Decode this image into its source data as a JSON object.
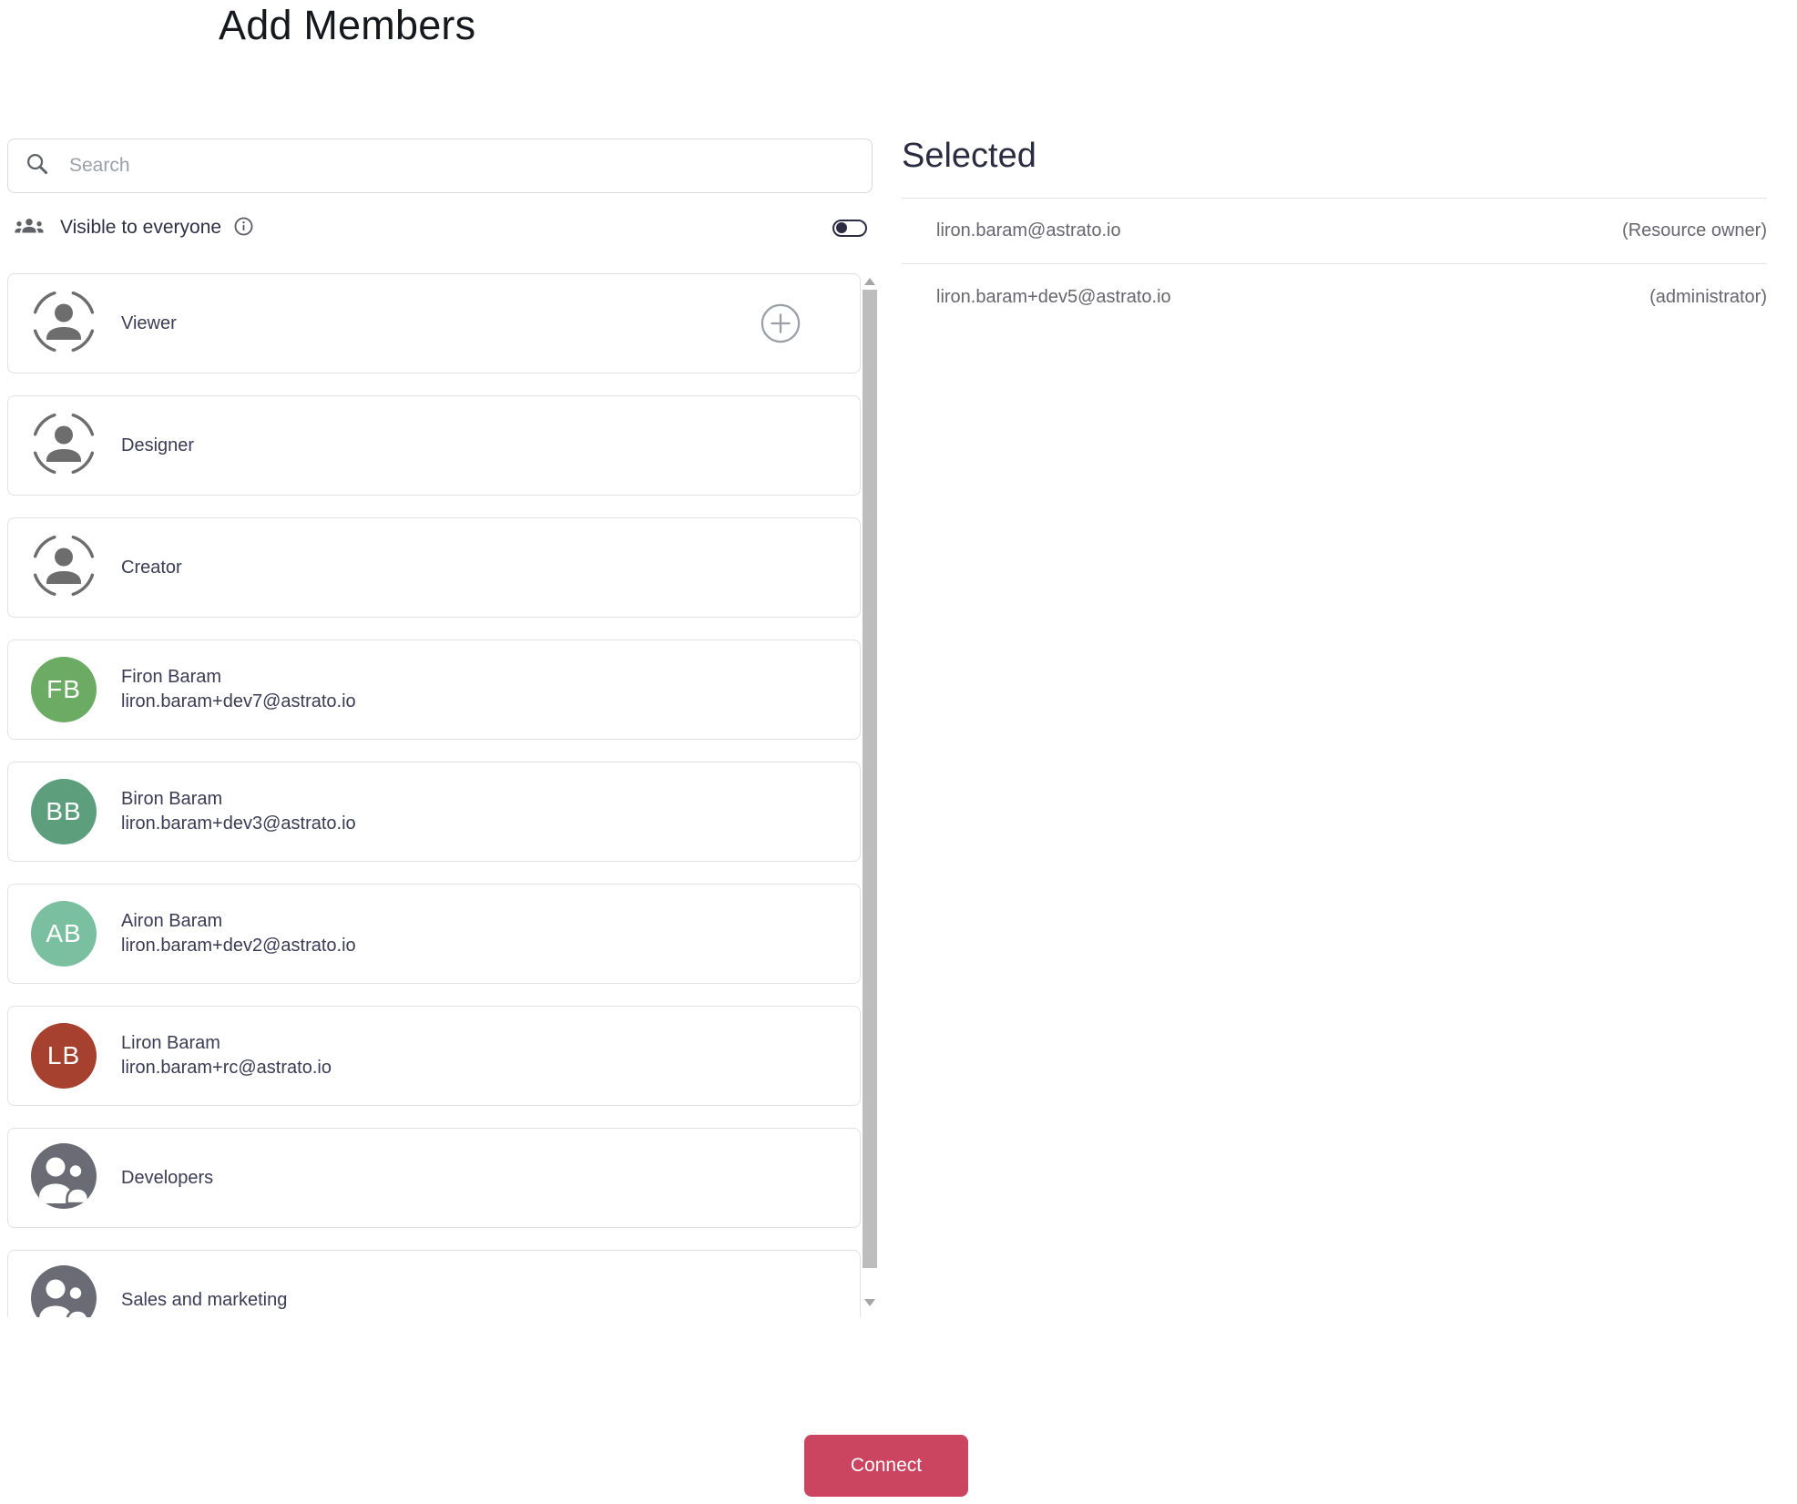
{
  "page": {
    "title": "Add Members"
  },
  "search": {
    "placeholder": "Search"
  },
  "visibility": {
    "label": "Visible to everyone",
    "toggle_state": "off"
  },
  "list": {
    "items": [
      {
        "type": "role",
        "label": "Viewer",
        "has_add_button": true
      },
      {
        "type": "role",
        "label": "Designer"
      },
      {
        "type": "role",
        "label": "Creator"
      },
      {
        "type": "user",
        "name": "Firon Baram",
        "email": "liron.baram+dev7@astrato.io",
        "initials": "FB",
        "color": "#6cab63"
      },
      {
        "type": "user",
        "name": "Biron Baram",
        "email": "liron.baram+dev3@astrato.io",
        "initials": "BB",
        "color": "#5d9e7d"
      },
      {
        "type": "user",
        "name": "Airon Baram",
        "email": "liron.baram+dev2@astrato.io",
        "initials": "AB",
        "color": "#79bfa0"
      },
      {
        "type": "user",
        "name": "Liron Baram",
        "email": "liron.baram+rc@astrato.io",
        "initials": "LB",
        "color": "#a6402f"
      },
      {
        "type": "group",
        "label": "Developers"
      },
      {
        "type": "group",
        "label": "Sales and marketing"
      }
    ]
  },
  "selected": {
    "title": "Selected",
    "rows": [
      {
        "email": "liron.baram@astrato.io",
        "role": "(Resource owner)"
      },
      {
        "email": "liron.baram+dev5@astrato.io",
        "role": "(administrator)"
      }
    ]
  },
  "footer": {
    "connect_label": "Connect",
    "connect_button_bg": "#cb4560"
  }
}
